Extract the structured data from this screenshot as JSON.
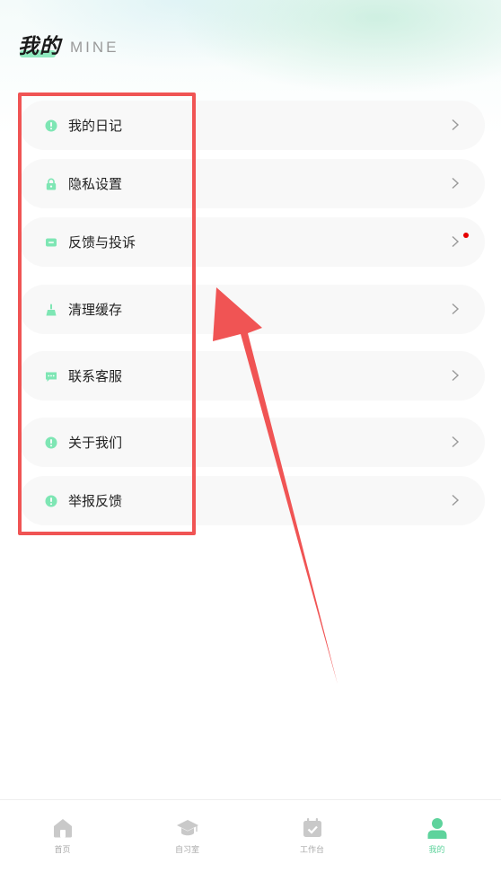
{
  "header": {
    "title_cn": "我的",
    "title_en": "MINE"
  },
  "menu": {
    "items": [
      {
        "label": "我的日记",
        "icon": "info-circle-icon"
      },
      {
        "label": "隐私设置",
        "icon": "lock-icon"
      },
      {
        "label": "反馈与投诉",
        "icon": "message-icon",
        "has_dot": true
      },
      {
        "label": "清理缓存",
        "icon": "broom-icon"
      },
      {
        "label": "联系客服",
        "icon": "chat-icon"
      },
      {
        "label": "关于我们",
        "icon": "info-circle-icon"
      },
      {
        "label": "举报反馈",
        "icon": "info-circle-icon"
      }
    ]
  },
  "tabbar": {
    "tabs": [
      {
        "label": "首页",
        "icon": "home-icon",
        "active": false
      },
      {
        "label": "自习室",
        "icon": "graduation-cap-icon",
        "active": false
      },
      {
        "label": "工作台",
        "icon": "calendar-check-icon",
        "active": false
      },
      {
        "label": "我的",
        "icon": "user-icon",
        "active": true
      }
    ]
  },
  "colors": {
    "accent": "#5ed39c",
    "highlight": "#f05454",
    "notification_dot": "#e60000",
    "item_background": "#f8f8f8"
  }
}
